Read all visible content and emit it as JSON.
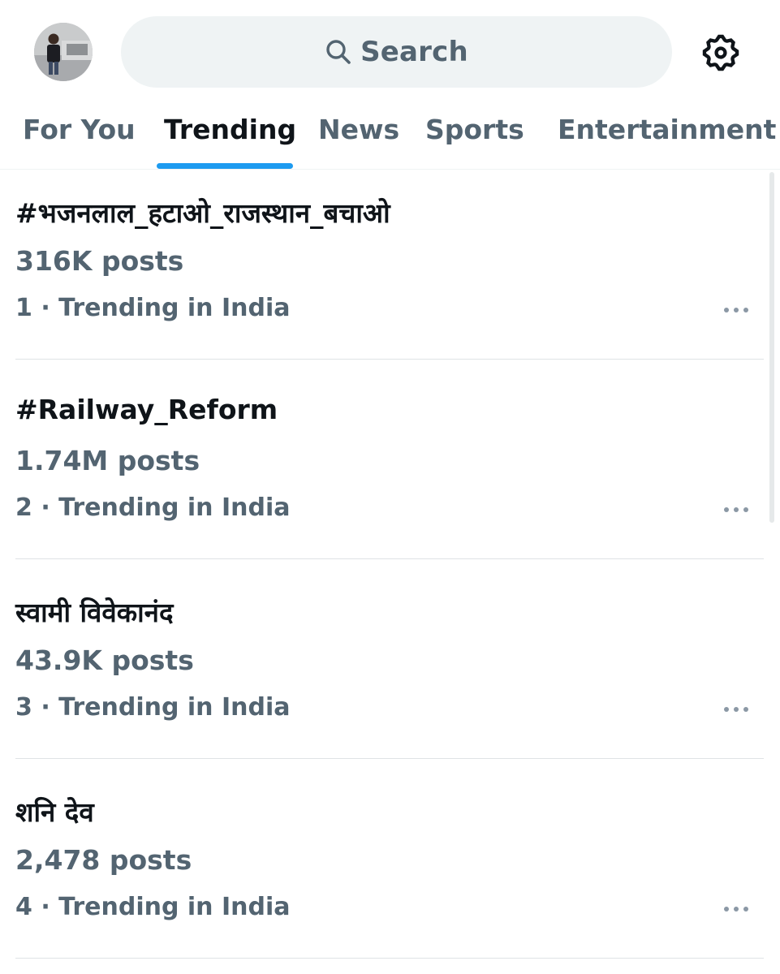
{
  "header": {
    "search_label": "Search",
    "avatar_icon": "user-avatar",
    "settings_icon": "gear-icon"
  },
  "tabs": [
    {
      "label": "For You",
      "active": false
    },
    {
      "label": "Trending",
      "active": true
    },
    {
      "label": "News",
      "active": false
    },
    {
      "label": "Sports",
      "active": false
    },
    {
      "label": "Entertainment",
      "active": false
    }
  ],
  "trends": [
    {
      "name": "#भजनलाल_हटाओ_राजस्थान_बचाओ",
      "posts": "316K posts",
      "rank": "1",
      "context": "Trending in India"
    },
    {
      "name": "#Railway_Reform",
      "posts": "1.74M posts",
      "rank": "2",
      "context": "Trending in India"
    },
    {
      "name": "स्वामी विवेकानंद",
      "posts": "43.9K posts",
      "rank": "3",
      "context": "Trending in India"
    },
    {
      "name": "शनि देव",
      "posts": "2,478 posts",
      "rank": "4",
      "context": "Trending in India"
    }
  ],
  "colors": {
    "accent": "#1d9bf0",
    "text_primary": "#0f1419",
    "text_secondary": "#536471",
    "search_bg": "#eff3f4"
  }
}
